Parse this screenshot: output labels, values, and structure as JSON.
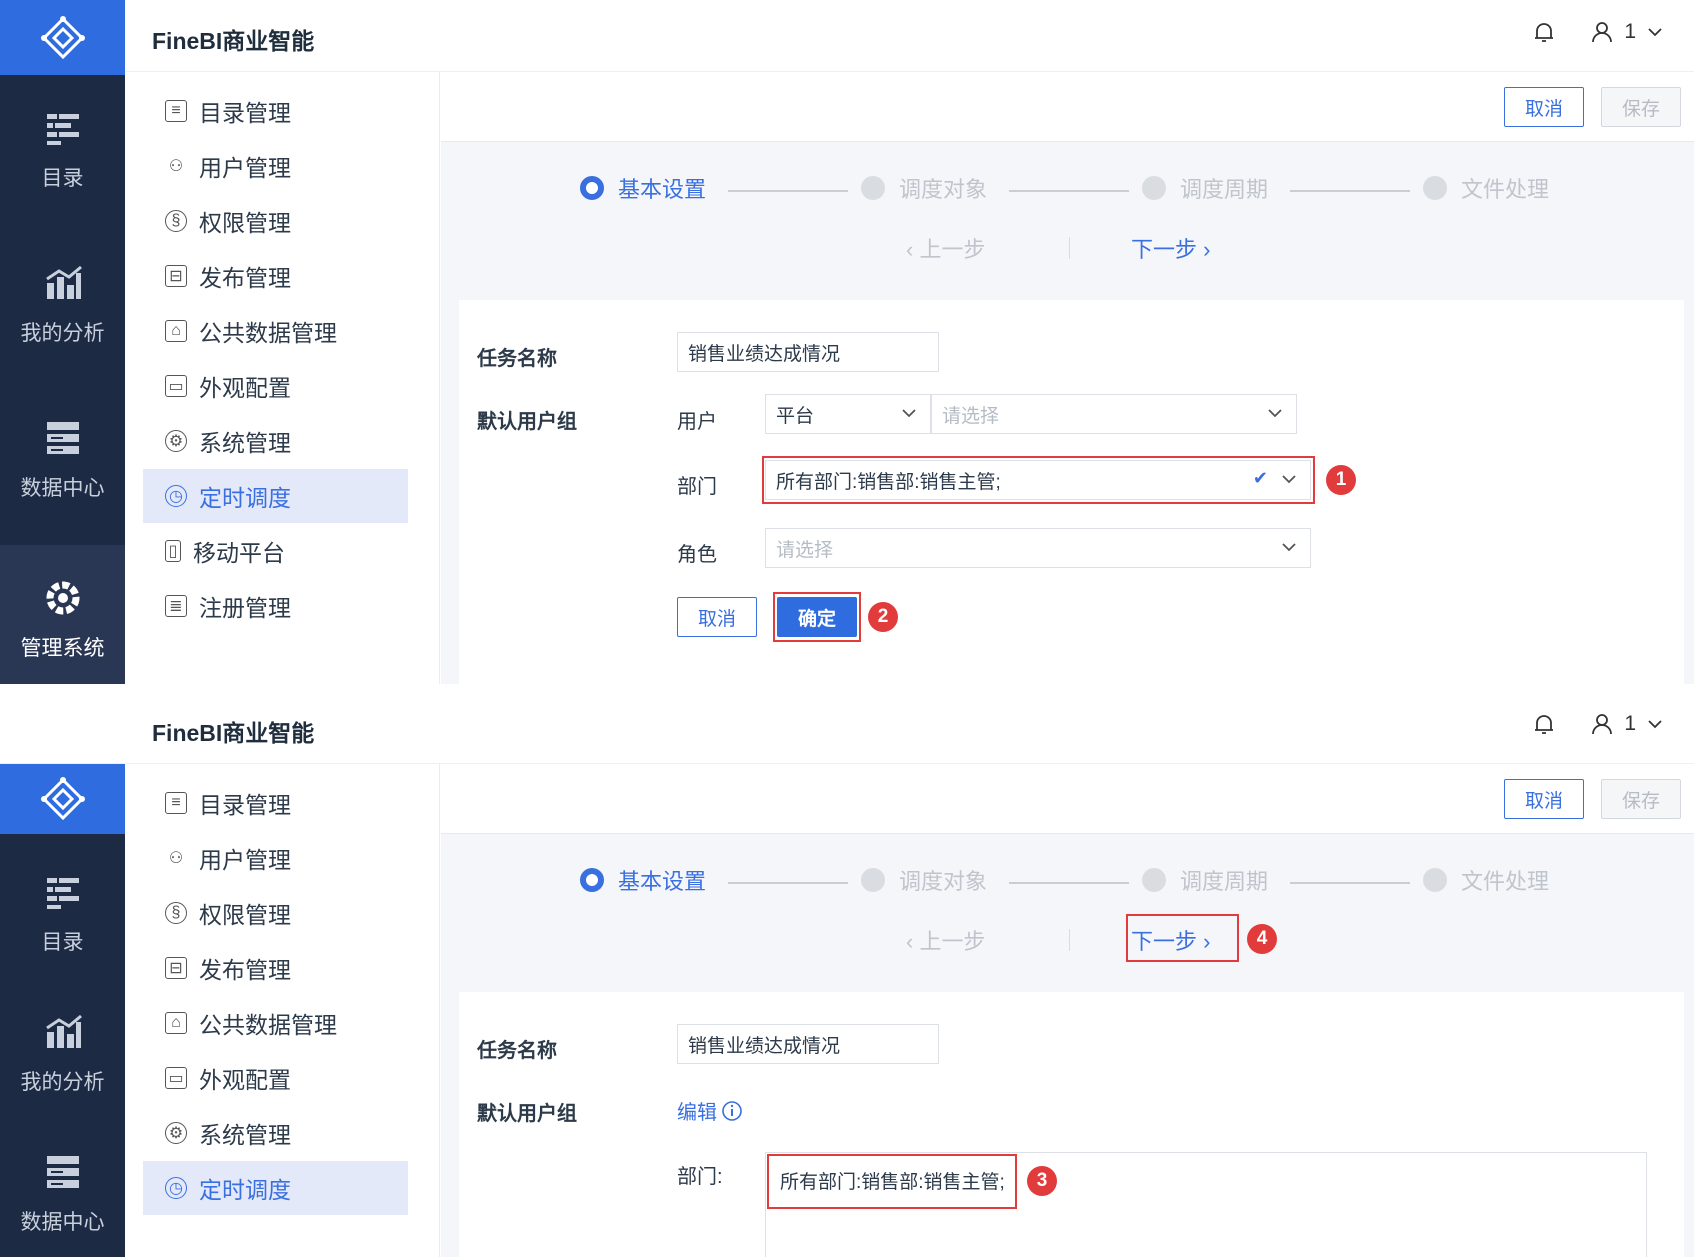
{
  "app": {
    "title": "FineBI商业智能",
    "user_name": "1"
  },
  "navbar": {
    "items": [
      {
        "label": "目录",
        "icon": "catalog-icon"
      },
      {
        "label": "我的分析",
        "icon": "analysis-icon"
      },
      {
        "label": "数据中心",
        "icon": "data-center-icon"
      },
      {
        "label": "管理系统",
        "icon": "admin-gear-icon"
      }
    ]
  },
  "menu": {
    "items": [
      {
        "label": "目录管理",
        "icon": "list-icon"
      },
      {
        "label": "用户管理",
        "icon": "user-icon"
      },
      {
        "label": "权限管理",
        "icon": "shield-icon"
      },
      {
        "label": "发布管理",
        "icon": "publish-icon"
      },
      {
        "label": "公共数据管理",
        "icon": "public-data-icon"
      },
      {
        "label": "外观配置",
        "icon": "appearance-icon"
      },
      {
        "label": "系统管理",
        "icon": "gear-icon"
      },
      {
        "label": "定时调度",
        "icon": "clock-icon",
        "active": true
      },
      {
        "label": "移动平台",
        "icon": "mobile-icon"
      },
      {
        "label": "注册管理",
        "icon": "register-icon"
      }
    ]
  },
  "toolbar": {
    "cancel": "取消",
    "save": "保存"
  },
  "steps": [
    "基本设置",
    "调度对象",
    "调度周期",
    "文件处理"
  ],
  "nav_buttons": {
    "prev": "上一步",
    "next": "下一步"
  },
  "form": {
    "task_name_label": "任务名称",
    "task_name_value": "销售业绩达成情况",
    "user_group_label": "默认用户组",
    "user_label": "用户",
    "user_type_value": "平台",
    "placeholder": "请选择",
    "dept_label": "部门",
    "dept_value": "所有部门:销售部:销售主管;",
    "role_label": "角色",
    "cancel": "取消",
    "confirm": "确定",
    "edit_link": "编辑",
    "dept_label_colon": "部门:"
  },
  "badges": [
    "1",
    "2",
    "3",
    "4"
  ],
  "colors": {
    "accent": "#2f6ce0",
    "nav_bg": "#1d2a44",
    "highlight": "#e23b3b"
  }
}
